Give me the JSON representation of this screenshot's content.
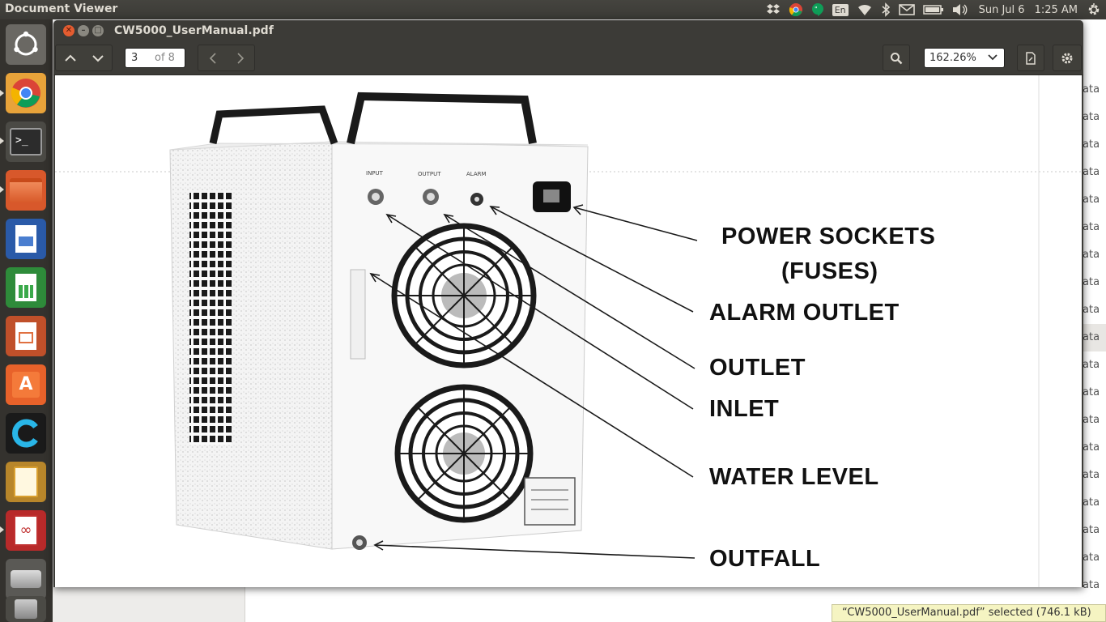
{
  "topbar": {
    "app_title": "Document Viewer",
    "keyboard": "En",
    "datetime": "Sun Jul 6",
    "time": "1:25 AM",
    "icons": [
      "dropbox-icon",
      "chrome-icon",
      "hangouts-icon",
      "keyboard-icon",
      "wifi-icon",
      "bluetooth-icon",
      "mail-icon",
      "battery-icon",
      "volume-icon",
      "gear-icon"
    ]
  },
  "launcher": {
    "items": [
      "ubuntu-dash",
      "chrome",
      "terminal",
      "files",
      "writer",
      "calc",
      "impress",
      "software-center",
      "c-app",
      "image-viewer",
      "pdf-app",
      "disk",
      "trash"
    ]
  },
  "window": {
    "title": "CW5000_UserManual.pdf",
    "page_current": "3",
    "page_total": "of 8",
    "zoom": "162.26%"
  },
  "diagram": {
    "labels": {
      "power": "POWER SOCKETS",
      "fuses": "(FUSES)",
      "alarm_outlet": "ALARM OUTLET",
      "outlet": "OUTLET",
      "inlet": "INLET",
      "water_level": "WATER LEVEL",
      "outfall": "OUTFALL"
    },
    "panel_labels": {
      "input": "INPUT",
      "output": "OUTPUT",
      "alarm": "ALARM"
    }
  },
  "background": {
    "row_text": "ata",
    "status": "“CW5000_UserManual.pdf” selected  (746.1 kB)"
  }
}
